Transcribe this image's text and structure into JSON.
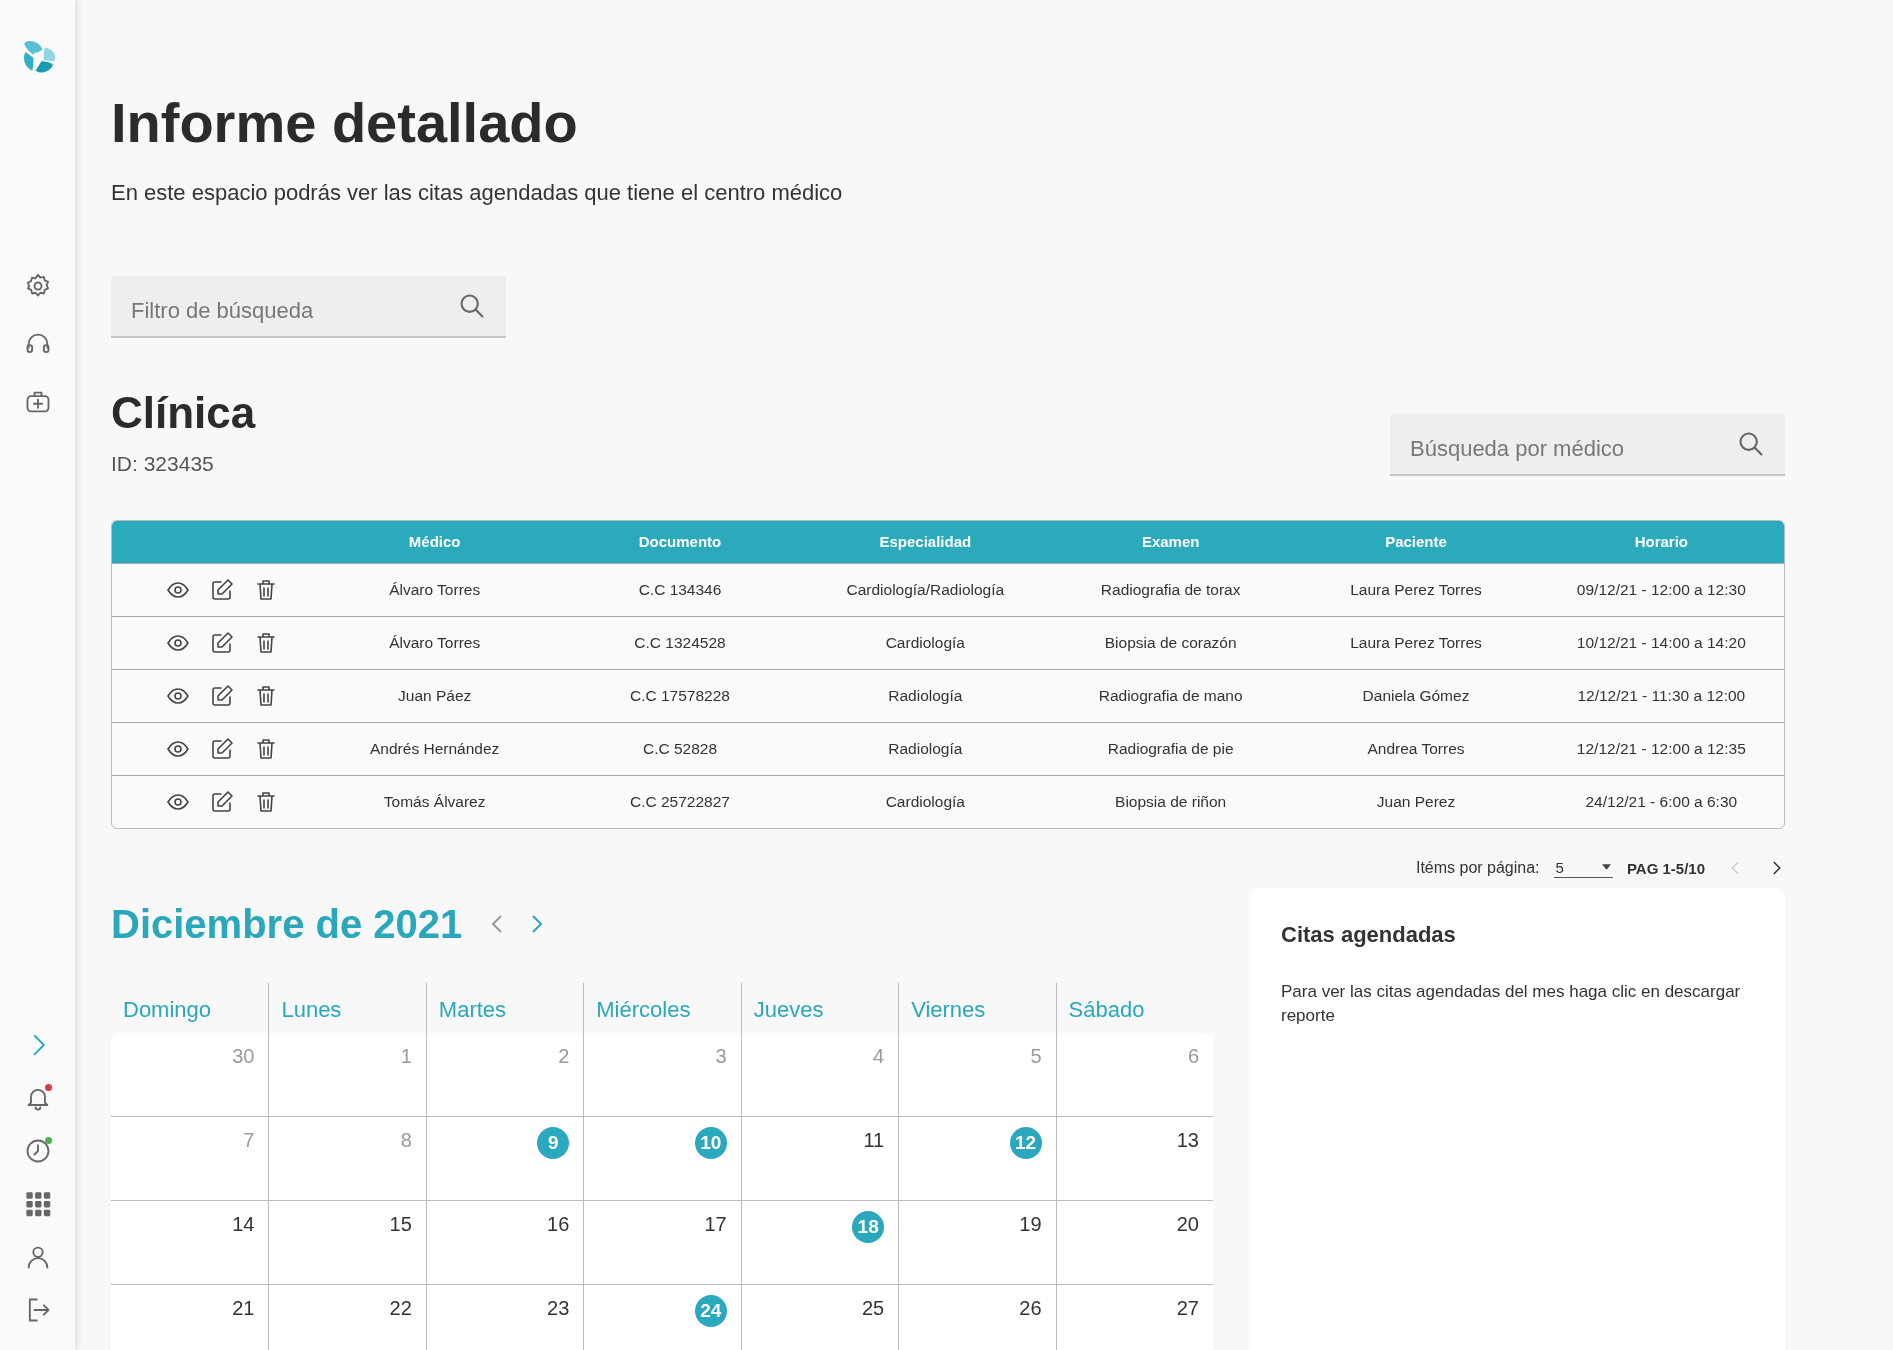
{
  "sidebar": {
    "top_items": [
      {
        "kind": "settings"
      },
      {
        "kind": "headset"
      },
      {
        "kind": "medkit"
      }
    ],
    "bottom_items": [
      {
        "kind": "expand"
      },
      {
        "kind": "bell",
        "color": "#e0393e"
      },
      {
        "kind": "clock",
        "color": "#4cb050"
      },
      {
        "kind": "apps"
      },
      {
        "kind": "user"
      },
      {
        "kind": "logout"
      }
    ]
  },
  "page": {
    "title": "Informe detallado",
    "subtitle": "En este espacio podrás ver las citas agendadas que tiene el centro médico"
  },
  "search": {
    "placeholder": "Filtro de búsqueda"
  },
  "clinic": {
    "title": "Clínica",
    "id": "ID: 323435",
    "doctor_search": {
      "placeholder": "Búsqueda por médico"
    }
  },
  "table": {
    "columns": [
      "Médico",
      "Documento",
      "Especialidad",
      "Examen",
      "Paciente",
      "Horario"
    ],
    "rows": [
      [
        "Álvaro Torres",
        "C.C 134346",
        "Cardiología/Radiología",
        "Radiografia de torax",
        "Laura Perez Torres",
        "09/12/21 - 12:00 a 12:30"
      ],
      [
        "Álvaro Torres",
        "C.C 1324528",
        "Cardiología",
        "Biopsia de corazón",
        "Laura Perez Torres",
        "10/12/21 - 14:00 a 14:20"
      ],
      [
        "Juan Páez",
        "C.C 17578228",
        "Radiología",
        "Radiografia de mano",
        "Daniela Gómez",
        "12/12/21 - 11:30 a 12:00"
      ],
      [
        "Andrés Hernández",
        "C.C 52828",
        "Radiología",
        "Radiografia de pie",
        "Andrea Torres",
        "12/12/21 - 12:00 a 12:35"
      ],
      [
        "Tomás Álvarez",
        "C.C 25722827",
        "Cardiología",
        "Biopsia de riñon",
        "Juan Perez",
        "24/12/21 - 6:00 a 6:30"
      ]
    ]
  },
  "pagination": {
    "label": "Itéms por página:",
    "per_page": "5",
    "range": "PAG 1-5/10",
    "prev_disabled": true,
    "next_disabled": false
  },
  "calendar": {
    "title": "Diciembre de 2021",
    "weekdays": [
      "Domingo",
      "Lunes",
      "Martes",
      "Miércoles",
      "Jueves",
      "Viernes",
      "Sábado"
    ],
    "weeks": [
      [
        {
          "day": "30",
          "muted": true,
          "marked": false
        },
        {
          "day": "1",
          "muted": true,
          "marked": false
        },
        {
          "day": "2",
          "muted": true,
          "marked": false
        },
        {
          "day": "3",
          "muted": true,
          "marked": false
        },
        {
          "day": "4",
          "muted": true,
          "marked": false
        },
        {
          "day": "5",
          "muted": true,
          "marked": false
        },
        {
          "day": "6",
          "muted": true,
          "marked": false
        }
      ],
      [
        {
          "day": "7",
          "muted": true,
          "marked": false
        },
        {
          "day": "8",
          "muted": true,
          "marked": false
        },
        {
          "day": "9",
          "muted": false,
          "marked": true
        },
        {
          "day": "10",
          "muted": false,
          "marked": true
        },
        {
          "day": "11",
          "muted": false,
          "marked": false
        },
        {
          "day": "12",
          "muted": false,
          "marked": true
        },
        {
          "day": "13",
          "muted": false,
          "marked": false
        }
      ],
      [
        {
          "day": "14",
          "muted": false,
          "marked": false
        },
        {
          "day": "15",
          "muted": false,
          "marked": false
        },
        {
          "day": "16",
          "muted": false,
          "marked": false
        },
        {
          "day": "17",
          "muted": false,
          "marked": false
        },
        {
          "day": "18",
          "muted": false,
          "marked": true
        },
        {
          "day": "19",
          "muted": false,
          "marked": false
        },
        {
          "day": "20",
          "muted": false,
          "marked": false
        }
      ],
      [
        {
          "day": "21",
          "muted": false,
          "marked": false
        },
        {
          "day": "22",
          "muted": false,
          "marked": false
        },
        {
          "day": "23",
          "muted": false,
          "marked": false
        },
        {
          "day": "24",
          "muted": false,
          "marked": true
        },
        {
          "day": "25",
          "muted": false,
          "marked": false
        },
        {
          "day": "26",
          "muted": false,
          "marked": false
        },
        {
          "day": "27",
          "muted": false,
          "marked": false
        }
      ]
    ]
  },
  "appointments": {
    "title": "Citas agendadas",
    "text": "Para ver las citas agendadas del mes haga clic en descargar reporte"
  }
}
